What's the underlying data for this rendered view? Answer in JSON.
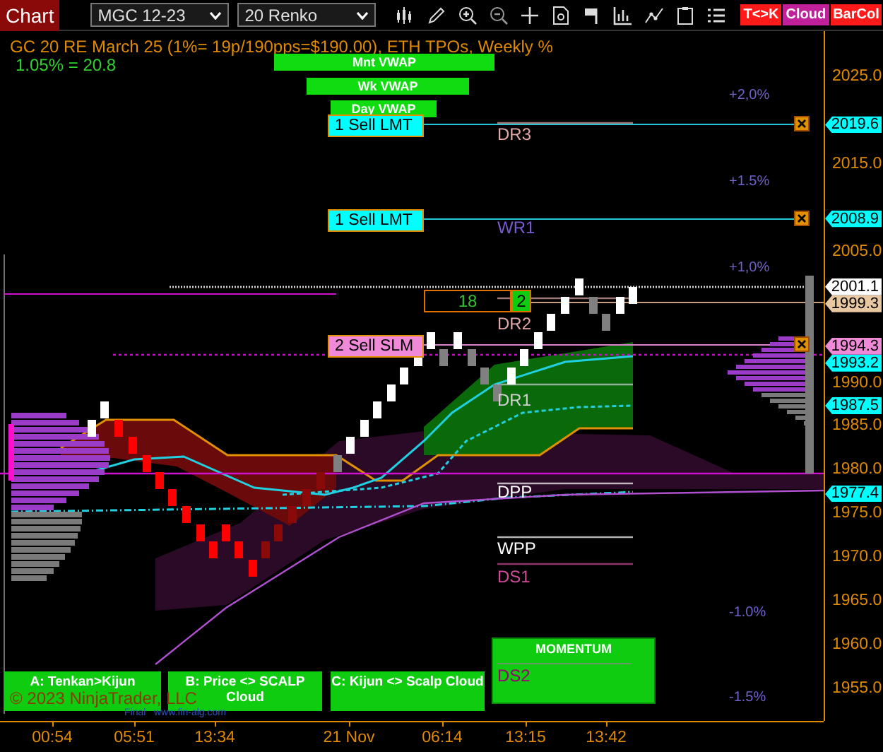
{
  "toolbar": {
    "title": "Chart",
    "instrument": "MGC 12-23",
    "period": "20 Renko",
    "toggles": [
      {
        "label": "T<>K",
        "color": "#ff1a1a"
      },
      {
        "label": "Cloud",
        "color": "#c0209a"
      },
      {
        "label": "BarCol",
        "color": "#ff1a1a"
      }
    ]
  },
  "chart": {
    "header": "GC 20 RE March 25 (1%= 19p/190pps=$190.00), ETH TPOs, Weekly %",
    "subheader": "1.05% = 20.8",
    "vwap_labels": [
      "Mnt VWAP",
      "Wk VWAP",
      "Day VWAP"
    ],
    "percent_labels": [
      "+2,0%",
      "+1.5%",
      "+1,0%",
      "-1.0%",
      "-1.5%"
    ],
    "pivot_labels": [
      {
        "label": "DR3",
        "color": "#e0a8a8"
      },
      {
        "label": "WR1",
        "color": "#7a5ad0"
      },
      {
        "label": "DR2",
        "color": "#e0a8a8"
      },
      {
        "label": "DR1",
        "color": "#d0d0d0"
      },
      {
        "label": "DPP",
        "color": "#ffffff"
      },
      {
        "label": "WPP",
        "color": "#ffffff"
      },
      {
        "label": "DS1",
        "color": "#d04a9a"
      }
    ],
    "orders": [
      {
        "label": "1 Sell LMT",
        "color": "#00ffff"
      },
      {
        "label": "1 Sell LMT",
        "color": "#00ffff"
      },
      {
        "label": "2 Sell SLM",
        "color": "#f08ad8"
      }
    ],
    "position": {
      "count": "18",
      "quantity": "2"
    },
    "signal_buttons": [
      "A: Tenkan>Kijun",
      "B: Price <> SCALP Cloud",
      "C: Kijun <> Scalp Cloud"
    ],
    "momentum": {
      "title": "MOMENTUM",
      "pivot": "DS2"
    },
    "copyright": "© 2023 NinjaTrader, LLC",
    "vendor_note": "Final   www.fin-alg.com"
  },
  "price_axis": {
    "ticks": [
      "2025.0",
      "2015.0",
      "2005.0",
      "1990.0",
      "1985.0",
      "1980.0",
      "1975.0",
      "1970.0",
      "1965.0",
      "1960.0",
      "1955.0"
    ],
    "flags": [
      {
        "price": "2019.6",
        "color": "#00ffff"
      },
      {
        "price": "2008.9",
        "color": "#00ffff"
      },
      {
        "price": "2001.1",
        "color": "#ffffff"
      },
      {
        "price": "1999.3",
        "color": "#e8c8a0"
      },
      {
        "price": "1994.3",
        "color": "#f08ad8"
      },
      {
        "price": "1993.2",
        "color": "#00ffff"
      },
      {
        "price": "1987.5",
        "color": "#00ffff"
      },
      {
        "price": "1977.4",
        "color": "#00ffff"
      }
    ]
  },
  "time_axis": {
    "labels": [
      "00:54",
      "05:51",
      "13:34",
      "21 Nov",
      "06:14",
      "13:15",
      "13:42"
    ]
  }
}
